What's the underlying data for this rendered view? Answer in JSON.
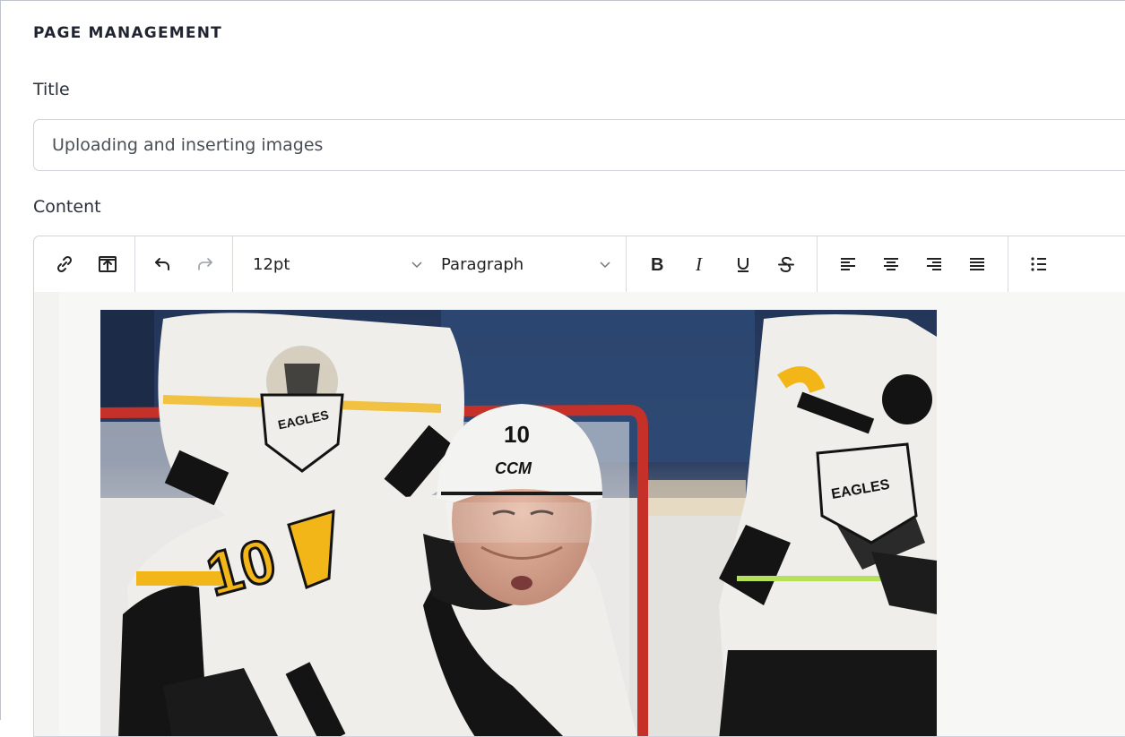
{
  "section": {
    "title": "PAGE MANAGEMENT"
  },
  "form": {
    "title_label": "Title",
    "title_value": "Uploading and inserting images",
    "content_label": "Content"
  },
  "toolbar": {
    "font_size": "12pt",
    "block_format": "Paragraph",
    "icons": [
      "link-icon",
      "upload-image-icon",
      "undo-icon",
      "redo-icon",
      "bold-icon",
      "italic-icon",
      "underline-icon",
      "strikethrough-icon",
      "align-left-icon",
      "align-center-icon",
      "align-right-icon",
      "align-justify-icon",
      "bullet-list-icon"
    ]
  },
  "image": {
    "jersey_number": "10",
    "helmet_brand": "CCM",
    "team_name": "EAGLES",
    "colors": {
      "jersey_white": "#efeeea",
      "gold": "#f2b619",
      "black": "#131313",
      "net_red": "#c53129"
    }
  }
}
